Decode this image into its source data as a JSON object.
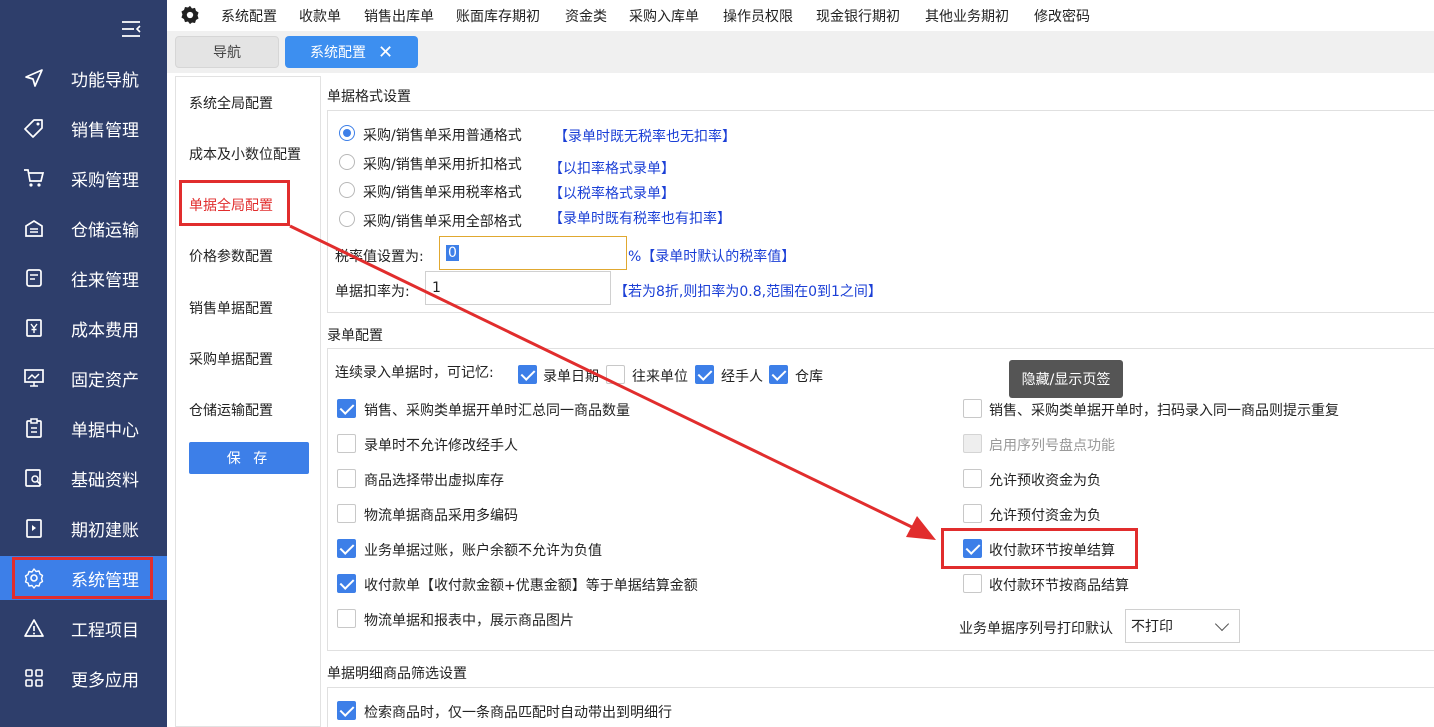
{
  "sidebar": {
    "items": [
      {
        "label": "功能导航",
        "icon": "send-icon"
      },
      {
        "label": "销售管理",
        "icon": "tag-icon"
      },
      {
        "label": "采购管理",
        "icon": "cart-icon"
      },
      {
        "label": "仓储运输",
        "icon": "warehouse-icon"
      },
      {
        "label": "往来管理",
        "icon": "ledger-icon"
      },
      {
        "label": "成本费用",
        "icon": "yuan-icon"
      },
      {
        "label": "固定资产",
        "icon": "monitor-icon"
      },
      {
        "label": "单据中心",
        "icon": "clipboard-icon"
      },
      {
        "label": "基础资料",
        "icon": "search-doc-icon"
      },
      {
        "label": "期初建账",
        "icon": "file-icon"
      },
      {
        "label": "系统管理",
        "icon": "gear-icon",
        "active": true
      },
      {
        "label": "工程项目",
        "icon": "warning-icon"
      },
      {
        "label": "更多应用",
        "icon": "grid-icon"
      }
    ]
  },
  "topmenu": [
    "系统配置",
    "收款单",
    "销售出库单",
    "账面库存期初",
    "资金类",
    "采购入库单",
    "操作员权限",
    "现金银行期初",
    "其他业务期初",
    "修改密码"
  ],
  "tabs": {
    "nav": "导航",
    "sys": "系统配置",
    "close": "✕"
  },
  "left_menu": [
    "系统全局配置",
    "成本及小数位配置",
    "单据全局配置",
    "价格参数配置",
    "销售单据配置",
    "采购单据配置",
    "仓储运输配置"
  ],
  "save_label": "保 存",
  "format_section": {
    "title": "单据格式设置",
    "options": [
      {
        "label": "采购/销售单采用普通格式",
        "note": "【录单时既无税率也无扣率】",
        "selected": true
      },
      {
        "label": "采购/销售单采用折扣格式",
        "note": "【以扣率格式录单】",
        "selected": false
      },
      {
        "label": "采购/销售单采用税率格式",
        "note": "【以税率格式录单】",
        "selected": false
      },
      {
        "label": "采购/销售单采用全部格式",
        "note": "【录单时既有税率也有扣率】",
        "selected": false
      }
    ],
    "tax_label": "税率值设置为:",
    "tax_value": "0",
    "tax_note": "%【录单时默认的税率值】",
    "discount_label": "单据扣率为:",
    "discount_value": "1",
    "discount_note": "【若为8折,则扣率为0.8,范围在0到1之间】"
  },
  "entry_section": {
    "title": "录单配置",
    "remember_label": "连续录入单据时，可记忆:",
    "remember": [
      {
        "label": "录单日期",
        "checked": true
      },
      {
        "label": "往来单位",
        "checked": false
      },
      {
        "label": "经手人",
        "checked": true
      },
      {
        "label": "仓库",
        "checked": true
      }
    ],
    "left": [
      {
        "label": "销售、采购类单据开单时汇总同一商品数量",
        "checked": true
      },
      {
        "label": "录单时不允许修改经手人",
        "checked": false
      },
      {
        "label": "商品选择带出虚拟库存",
        "checked": false
      },
      {
        "label": "物流单据商品采用多编码",
        "checked": false
      },
      {
        "label": "业务单据过账，账户余额不允许为负值",
        "checked": true
      },
      {
        "label": "收付款单【收付款金额+优惠金额】等于单据结算金额",
        "checked": true
      },
      {
        "label": "物流单据和报表中，展示商品图片",
        "checked": false
      }
    ],
    "right": [
      {
        "label": "销售、采购类单据开单时，扫码录入同一商品则提示重复",
        "checked": false
      },
      {
        "label": "启用序列号盘点功能",
        "checked": false,
        "disabled": true
      },
      {
        "label": "允许预收资金为负",
        "checked": false
      },
      {
        "label": "允许预付资金为负",
        "checked": false
      },
      {
        "label": "收付款环节按单结算",
        "checked": true
      },
      {
        "label": "收付款环节按商品结算",
        "checked": false
      }
    ],
    "serial_print_label": "业务单据序列号打印默认",
    "serial_print_value": "不打印",
    "tooltip": "隐藏/显示页签"
  },
  "filter_section": {
    "title": "单据明细商品筛选设置",
    "items": [
      {
        "label": "检索商品时，仅一条商品匹配时自动带出到明细行",
        "checked": true
      }
    ]
  },
  "colors": {
    "sidebar": "#2e3e6b",
    "accent": "#3d7fe8",
    "highlight": "#e12d2d",
    "note": "#1b3fd6"
  }
}
